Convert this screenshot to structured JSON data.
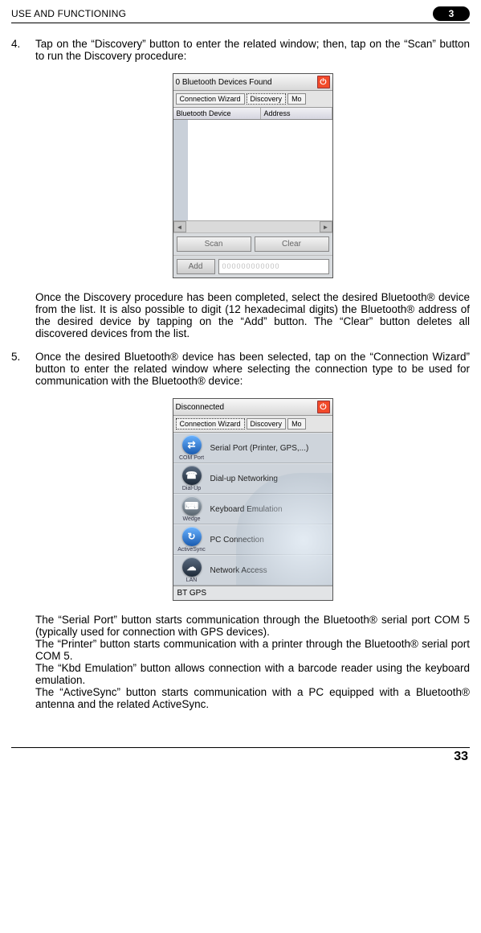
{
  "header": {
    "title": "USE AND FUNCTIONING",
    "page": "3"
  },
  "steps": {
    "s4": {
      "num": "4.",
      "text": "Tap on the “Discovery” button to enter the related window; then, tap on the “Scan” button to run the Discovery procedure:",
      "after": "Once the Discovery procedure has been completed, select the desired Bluetooth® device from the list. It is also possible to digit (12 hexadecimal digits) the Bluetooth® address of the desired device by tapping on the “Add” button. The “Clear” button deletes all discovered devices from the list."
    },
    "s5": {
      "num": "5.",
      "text": "Once the desired Bluetooth® device has been selected, tap on the “Connection Wizard” button to enter the related window where selecting the connection type to be used for communication with the Bluetooth® device:",
      "after": [
        "The “Serial Port” button starts communication through the Bluetooth® serial port COM 5 (typically used for connection with GPS devices).",
        "The “Printer” button starts communication with a printer through the Bluetooth® serial port COM 5.",
        "The “Kbd Emulation” button allows connection with a barcode reader using the keyboard emulation.",
        "The “ActiveSync” button starts communication with a PC equipped with a Bluetooth® antenna and the related ActiveSync."
      ]
    }
  },
  "figure1": {
    "title": "0 Bluetooth Devices Found",
    "tabs": {
      "cw": "Connection Wizard",
      "discovery": "Discovery",
      "more": "Mo"
    },
    "col1": "Bluetooth Device",
    "col2": "Address",
    "scan": "Scan",
    "clear": "Clear",
    "add": "Add",
    "addField": "000000000000"
  },
  "figure2": {
    "title": "Disconnected",
    "tabs": {
      "cw": "Connection Wizard",
      "discovery": "Discovery",
      "more": "Mo"
    },
    "items": [
      {
        "sublabel": "COM Port",
        "label": "Serial Port (Printer, GPS,...)",
        "glyph": "⇄",
        "iconStyle": "ic-blue"
      },
      {
        "sublabel": "Dial-Up",
        "label": "Dial-up Networking",
        "glyph": "☎",
        "iconStyle": "ic-dark"
      },
      {
        "sublabel": "Wedge",
        "label": "Keyboard Emulation",
        "glyph": "⌨",
        "iconStyle": "ic-grey"
      },
      {
        "sublabel": "ActiveSync",
        "label": "PC Connection",
        "glyph": "↻",
        "iconStyle": "ic-blue"
      },
      {
        "sublabel": "LAN",
        "label": "Network Access",
        "glyph": "☁",
        "iconStyle": "ic-dark"
      }
    ],
    "footer": "BT GPS"
  },
  "footer": {
    "page": "33"
  }
}
